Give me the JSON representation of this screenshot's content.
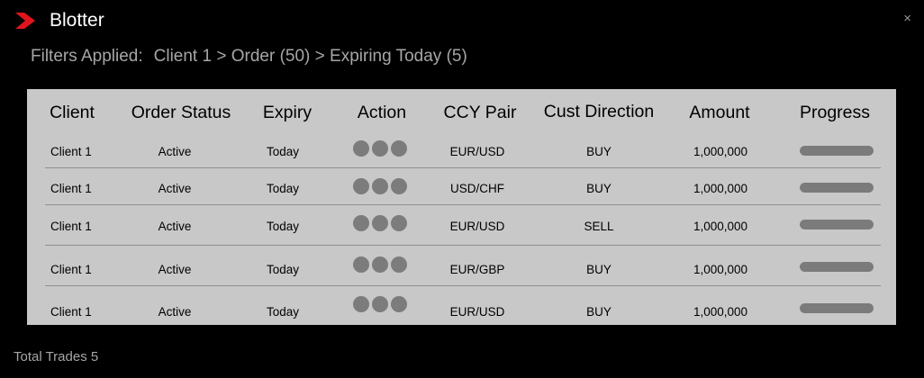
{
  "window": {
    "title": "Blotter",
    "close_glyph": "×",
    "logo_color": "#e0141e"
  },
  "filters": {
    "label": "Filters Applied:",
    "crumbs": [
      "Client 1",
      "Order (50)",
      "Expiring Today (5)"
    ],
    "separator": ">"
  },
  "table": {
    "headers": [
      "Client",
      "Order Status",
      "Expiry",
      "Action",
      "CCY Pair",
      "Cust Direction",
      "Amount",
      "Progress"
    ],
    "rows": [
      {
        "client": "Client 1",
        "status": "Active",
        "expiry": "Today",
        "pair": "EUR/USD",
        "direction": "BUY",
        "amount": "1,000,000",
        "progress": 1.0
      },
      {
        "client": "Client 1",
        "status": "Active",
        "expiry": "Today",
        "pair": "USD/CHF",
        "direction": "BUY",
        "amount": "1,000,000",
        "progress": 1.0
      },
      {
        "client": "Client 1",
        "status": "Active",
        "expiry": "Today",
        "pair": "EUR/USD",
        "direction": "SELL",
        "amount": "1,000,000",
        "progress": 1.0
      },
      {
        "client": "Client 1",
        "status": "Active",
        "expiry": "Today",
        "pair": "EUR/GBP",
        "direction": "BUY",
        "amount": "1,000,000",
        "progress": 1.0
      },
      {
        "client": "Client 1",
        "status": "Active",
        "expiry": "Today",
        "pair": "EUR/USD",
        "direction": "BUY",
        "amount": "1,000,000",
        "progress": 1.0
      }
    ],
    "action_icons": [
      "action-dot-icon",
      "action-dot-icon",
      "action-dot-icon"
    ]
  },
  "footer": {
    "total_trades": "Total Trades 5"
  },
  "colors": {
    "background": "#000000",
    "panel": "#c8c8c8",
    "muted_text": "#a6a6a6",
    "action_dot": "#7c7c7c",
    "progress_fill": "#7b7b7b"
  }
}
